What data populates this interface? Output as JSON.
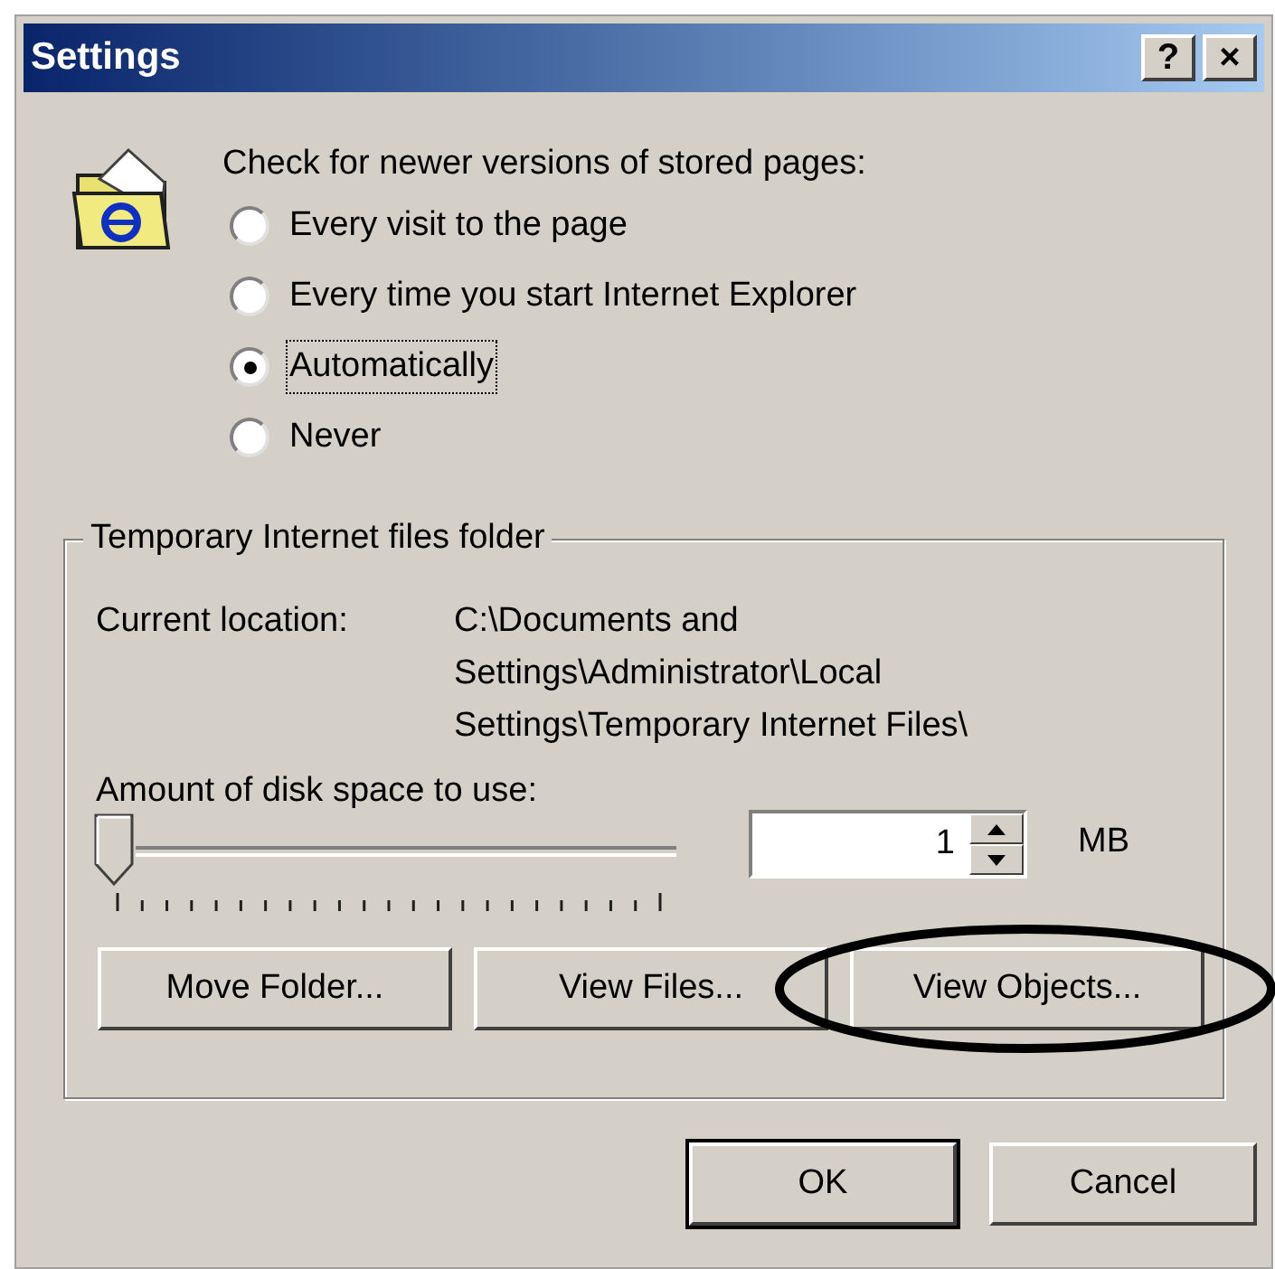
{
  "window": {
    "title": "Settings",
    "title_buttons": [
      "?",
      "×"
    ]
  },
  "check_section": {
    "heading": "Check for newer versions of stored pages:",
    "options": [
      {
        "label": "Every visit to the page",
        "selected": false
      },
      {
        "label": "Every time you start Internet Explorer",
        "selected": false
      },
      {
        "label": "Automatically",
        "selected": true
      },
      {
        "label": "Never",
        "selected": false
      }
    ]
  },
  "temp_folder": {
    "title": "Temporary Internet files folder",
    "location_label": "Current location:",
    "location_lines": [
      "C:\\Documents and",
      "Settings\\Administrator\\Local",
      "Settings\\Temporary Internet Files\\"
    ],
    "disk_label": "Amount of disk space to use:",
    "slider": {
      "level": 0
    },
    "size_value": "1",
    "size_unit": "MB",
    "buttons": [
      {
        "label": "Move Folder...",
        "circled": false
      },
      {
        "label": "View Files...",
        "circled": false
      },
      {
        "label": "View Objects...",
        "circled": true
      }
    ]
  },
  "buttons": [
    {
      "label": "OK",
      "default": true
    },
    {
      "label": "Cancel",
      "default": false
    }
  ]
}
